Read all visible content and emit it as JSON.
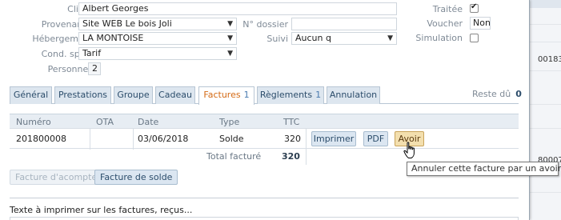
{
  "form": {
    "client_label": "Client",
    "client_value": "Albert Georges",
    "provenance_label": "Provenance",
    "provenance_value": "Site WEB Le bois Joli",
    "dossier_label": "N° dossier",
    "dossier_value": "",
    "hebergement_label": "Hébergement",
    "hebergement_value": "LA MONTOISE",
    "suivi_label": "Suivi",
    "suivi_value": "Aucun q",
    "cond_label": "Cond. spéc.",
    "cond_value": "Tarif",
    "personnes_label": "Personnes",
    "personnes_value": "2",
    "traitee_label": "Traitée",
    "traitee_checked": true,
    "voucher_label": "Voucher",
    "voucher_value": "Non",
    "simulation_label": "Simulation",
    "simulation_checked": false
  },
  "tabs": [
    {
      "label": "Général",
      "count": ""
    },
    {
      "label": "Prestations",
      "count": ""
    },
    {
      "label": "Groupe",
      "count": ""
    },
    {
      "label": "Cadeau",
      "count": ""
    },
    {
      "label": "Factures",
      "count": "1",
      "active": true
    },
    {
      "label": "Règlements",
      "count": "1"
    },
    {
      "label": "Annulation",
      "count": ""
    }
  ],
  "reste": {
    "label": "Reste dû",
    "value": "0"
  },
  "invoices": {
    "columns": [
      "Numéro",
      "OTA",
      "Date",
      "Type",
      "TTC"
    ],
    "rows": [
      {
        "numero": "201800008",
        "ota": "",
        "date": "03/06/2018",
        "type": "Solde",
        "ttc": "320"
      }
    ],
    "buttons": {
      "print": "Imprimer",
      "pdf": "PDF",
      "avoir": "Avoir"
    },
    "total_label": "Total facturé",
    "total_value": "320"
  },
  "actions": {
    "acompte": "Facture d'acompte",
    "solde": "Facture de solde"
  },
  "tooltip": "Annuler cette facture par un avoir",
  "footer_label": "Texte à imprimer sur les factures, reçus...",
  "background": {
    "num1": "00183",
    "num2": "80007"
  }
}
